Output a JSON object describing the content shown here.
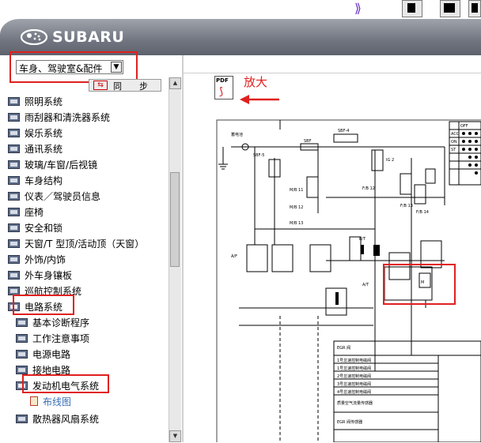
{
  "app": {
    "brand": "SUBARU"
  },
  "section_select": {
    "value": "车身、驾驶室&配件",
    "arrow": "chevron-down"
  },
  "sync_button": {
    "label": "同步"
  },
  "tree": {
    "items": [
      {
        "label": "照明系统"
      },
      {
        "label": "雨刮器和清洗器系统"
      },
      {
        "label": "娱乐系统"
      },
      {
        "label": "通讯系统"
      },
      {
        "label": "玻璃/车窗/后视镜"
      },
      {
        "label": "车身结构"
      },
      {
        "label": "仪表／驾驶员信息"
      },
      {
        "label": "座椅"
      },
      {
        "label": "安全和锁"
      },
      {
        "label": "天窗/T 型顶/活动顶（天窗）"
      },
      {
        "label": "外饰/内饰"
      },
      {
        "label": "外车身镶板"
      },
      {
        "label": "巡航控制系统"
      },
      {
        "label": "电路系统"
      }
    ],
    "children": [
      {
        "label": "基本诊断程序"
      },
      {
        "label": "工作注意事项"
      },
      {
        "label": "电源电路"
      },
      {
        "label": "接地电路"
      },
      {
        "label": "发动机电气系统"
      }
    ],
    "leaf": {
      "label": "布线图"
    },
    "after": {
      "label": "散热器风扇系统"
    }
  },
  "document": {
    "zoom_label": "放大",
    "pdf_icon_text": "PDF",
    "diagram": {
      "labels": [
        "蓄电池",
        "SBF",
        "SBF-4",
        "SBF-5",
        "IG 2",
        "F/B 12",
        "F/B 13",
        "F/B 14",
        "M/B 11",
        "M/B 12",
        "M/B 13",
        "A/F",
        "EGR 阀",
        "B/T",
        "A/T",
        "M",
        "OFF",
        "ACC",
        "ON",
        "ST"
      ],
      "egr_rows": [
        "EGR 阀",
        "1号怠速控制电磁阀",
        "1号怠速控制电磁阀",
        "2号怠速控制电磁阀",
        "3号怠速控制电磁阀",
        "4号怠速控制电磁阀",
        "质量空气流量传感器",
        "EGR 阀传感器"
      ]
    }
  },
  "colors": {
    "highlight": "#e02020",
    "header_top": "#9fa3ab",
    "header_bottom": "#5d626c",
    "link": "#3a6fb5"
  }
}
